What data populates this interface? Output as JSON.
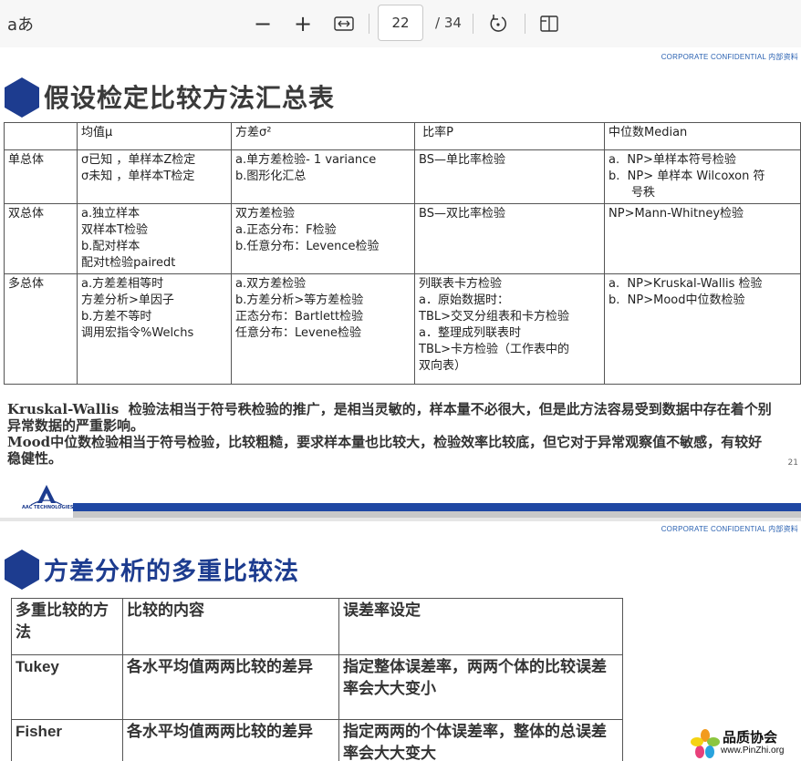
{
  "toolbar": {
    "read_aloud_label": "aあ",
    "zoom_out_glyph": "−",
    "zoom_in_glyph": "+",
    "current_page": "22",
    "total_pages": "/ 34",
    "icons": [
      "zoom-out-icon",
      "zoom-in-icon",
      "fit-width-icon",
      "rotate-icon",
      "page-view-icon"
    ]
  },
  "page1": {
    "confidential": "CORPORATE CONFIDENTIAL   内部资料",
    "title": "假设检定比较方法汇总表",
    "table": {
      "headers": [
        "",
        "均值μ",
        "方差σ²",
        " 比率P",
        "中位数Median"
      ],
      "rows": [
        {
          "label": "单总体",
          "mean": [
            "σ已知 ，单样本Z检定",
            "σ未知 ，单样本T检定"
          ],
          "variance": [
            "a.单方差检验- 1 variance",
            "b.图形化汇总"
          ],
          "ratio": [
            "BS—单比率检验"
          ],
          "median_a_marker": "a.",
          "median_a": "NP>单样本符号检验",
          "median_b_marker": "b.",
          "median_b": "NP> 单样本 Wilcoxon 符",
          "median_b2": "号秩"
        },
        {
          "label": "双总体",
          "mean": [
            "a.独立样本",
            "双样本T检验",
            "b.配对样本",
            "配对t检验pairedt"
          ],
          "variance": [
            "双方差检验",
            "a.正态分布：F检验",
            "b.任意分布：Levence检验"
          ],
          "ratio": [
            "BS—双比率检验"
          ],
          "median": "NP>Mann-Whitney检验"
        },
        {
          "label": "多总体",
          "mean": [
            "a.方差差相等时",
            "方差分析>单因子",
            "b.方差不等时",
            "调用宏指令%Welchs"
          ],
          "variance": [
            "a.双方差检验",
            "b.方差分析>等方差检验",
            "正态分布：Bartlett检验",
            "任意分布：Levene检验"
          ],
          "ratio": [
            "列联表卡方检验",
            "a．原始数据时：",
            "TBL>交叉分组表和卡方检验",
            "a．整理成列联表时",
            "TBL>卡方检验（工作表中的",
            "双向表）"
          ],
          "median_a_marker": "a.",
          "median_a": "NP>Kruskal-Wallis 检验",
          "median_b_marker": "b.",
          "median_b": "NP>Mood中位数检验"
        }
      ]
    },
    "notes": {
      "p1_latin": "Kruskal-Wallis",
      "p1_text": "  检验法相当于符号秩检验的推广，是相当灵敏的，样本量不必很大，但是此方法容易受到数据中存在着个别异常数据的严重影响。",
      "p2_latin": "Mood",
      "p2_text": "中位数检验相当于符号检验，比较粗糙，要求样本量也比较大，检验效率比较底，但它对于异常观察值不敏感，有较好稳健性。"
    },
    "page_number": "21",
    "logo_text": "AAC TECHNOLOGIES"
  },
  "page2": {
    "confidential": "CORPORATE CONFIDENTIAL   内部资料",
    "title": "方差分析的多重比较法",
    "table": {
      "headers": [
        "多重比较的方法",
        "比较的内容",
        "误差率设定"
      ],
      "rows": [
        {
          "method": "Tukey",
          "content": "各水平均值两两比较的差异",
          "error_rate": "指定整体误差率，两两个体的比较误差率会大大变小"
        },
        {
          "method": "Fisher",
          "content": "各水平均值两两比较的差异",
          "error_rate": "指定两两的个体误差率，整体的总误差率会大大变大"
        }
      ]
    }
  },
  "watermark": {
    "name": "品质协会",
    "url": "www.PinZhi.org"
  },
  "colors": {
    "accent_blue": "#1d3c8f",
    "band_blue": "#1f47a3",
    "confidential_blue": "#2b62b2"
  }
}
